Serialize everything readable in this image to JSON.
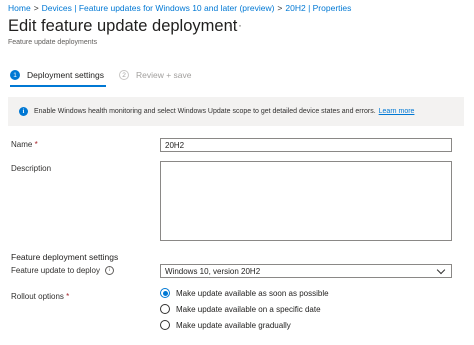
{
  "breadcrumb": {
    "home": "Home",
    "devices": "Devices | Feature updates for Windows 10 and later (preview)",
    "item": "20H2 | Properties",
    "separator": ">"
  },
  "header": {
    "title": "Edit feature update deployment",
    "more": "···",
    "subtitle": "Feature update deployments"
  },
  "steps": [
    {
      "number": "1",
      "label": "Deployment settings",
      "active": true
    },
    {
      "number": "2",
      "label": "Review + save",
      "active": false
    }
  ],
  "info": {
    "icon": "info-icon",
    "message": "Enable Windows health monitoring and select Windows Update scope to get detailed device states and errors.",
    "link": "Learn more"
  },
  "form": {
    "name_label": "Name",
    "required_mark": "*",
    "name_value": "20H2",
    "description_label": "Description",
    "description_value": "",
    "section_title": "Feature deployment settings",
    "feature_label": "Feature update to deploy",
    "feature_value": "Windows 10, version 20H2",
    "rollout_label": "Rollout options",
    "rollout_options": [
      {
        "label": "Make update available as soon as possible",
        "selected": true
      },
      {
        "label": "Make update available on a specific date",
        "selected": false
      },
      {
        "label": "Make update available gradually",
        "selected": false
      }
    ]
  },
  "colors": {
    "accent": "#0078d4",
    "required": "#a4262c",
    "info_bg": "#f3f2f1"
  }
}
